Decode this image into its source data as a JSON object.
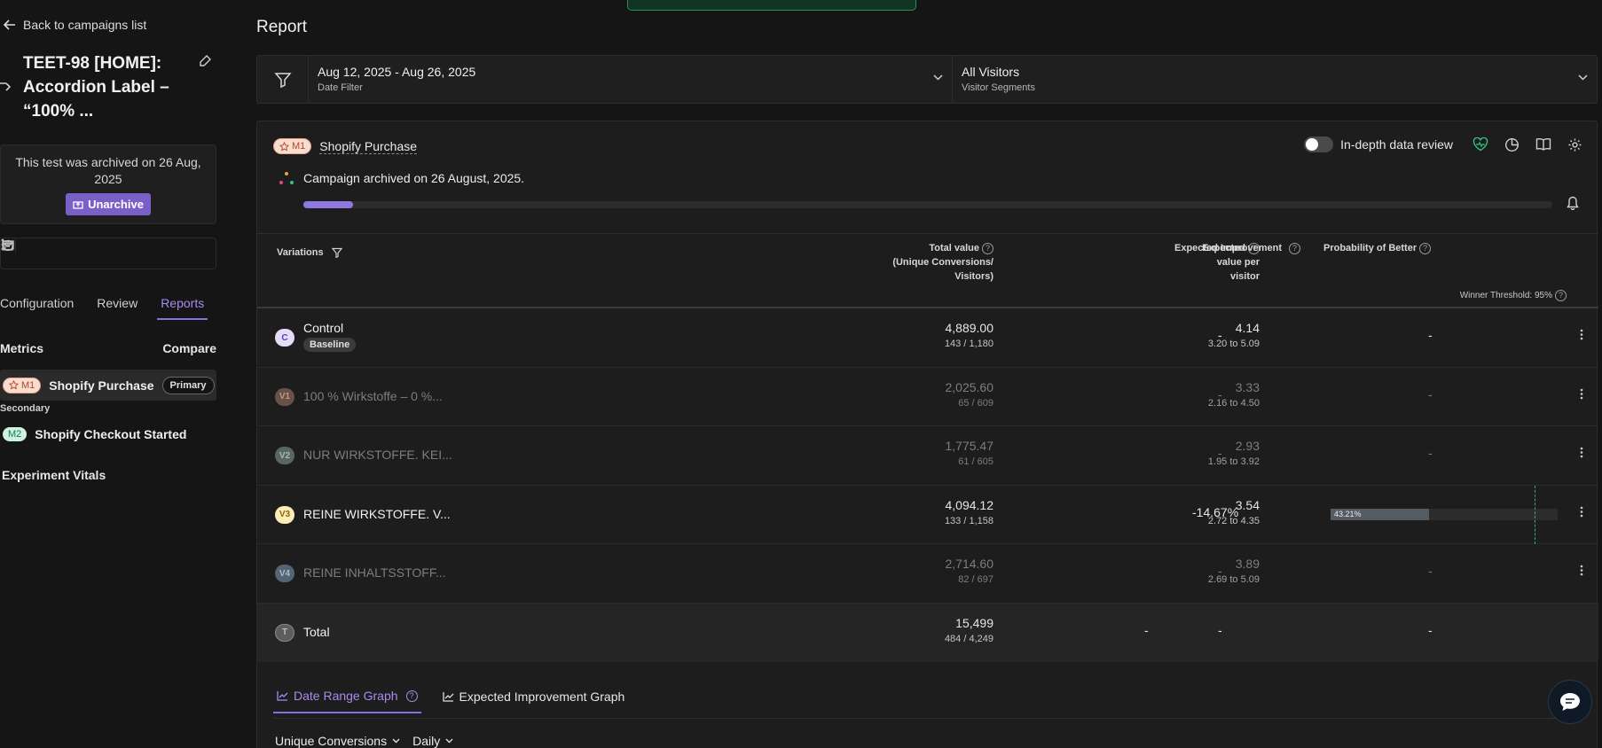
{
  "sidebar": {
    "back_label": "Back to campaigns list",
    "campaign_title": "TEET-98 [HOME]: Accordion Label – “100% ...",
    "archived_notice": "This test was archived on 26 Aug, 2025",
    "unarchive_label": "Unarchive",
    "tabs": [
      "Configuration",
      "Review",
      "Reports"
    ],
    "active_tab": "Reports",
    "metrics_heading": "Metrics",
    "compare_label": "Compare",
    "primary_metric": {
      "badge": "M1",
      "name": "Shopify Purchase",
      "tag": "Primary"
    },
    "secondary_label": "Secondary",
    "secondary_metric": {
      "badge": "M2",
      "name": "Shopify Checkout Started"
    },
    "vitals_label": "Experiment Vitals"
  },
  "main": {
    "title": "Report",
    "date_filter": {
      "value": "Aug 12, 2025 - Aug 26, 2025",
      "label": "Date Filter"
    },
    "segment_filter": {
      "value": "All Visitors",
      "label": "Visitor Segments"
    },
    "metric": {
      "badge": "M1",
      "name": "Shopify Purchase"
    },
    "in_depth_label": "In-depth data review",
    "archived_line": "Campaign archived on 26 August, 2025.",
    "progress_fraction": 0.04,
    "table": {
      "headers": {
        "variations": "Variations",
        "total_value_1": "Total value",
        "total_value_2": "(Unique Conversions/",
        "total_value_3": "Visitors)",
        "expected_1": "Expected",
        "expected_2": "value per",
        "expected_3": "visitor",
        "improvement": "Expected Improvement",
        "pob": "Probability of Better",
        "threshold": "Winner Threshold: 95%"
      },
      "rows": [
        {
          "badge": "C",
          "name": "Control",
          "tag": "Baseline",
          "total": "4,889.00",
          "conv": "143 / 1,180",
          "expected": "4.14",
          "range": "3.20 to 5.09",
          "improvement": "-",
          "pob": "-"
        },
        {
          "badge": "V1",
          "name": "100 % Wirkstoffe – 0 %...",
          "total": "2,025.60",
          "conv": "65 / 609",
          "expected": "3.33",
          "range": "2.16 to 4.50",
          "improvement": "-",
          "pob": "-"
        },
        {
          "badge": "V2",
          "name": "NUR WIRKSTOFFE. KEI...",
          "total": "1,775.47",
          "conv": "61 / 605",
          "expected": "2.93",
          "range": "1.95 to 3.92",
          "improvement": "-",
          "pob": "-"
        },
        {
          "badge": "V3",
          "name": "REINE WIRKSTOFFE. V...",
          "total": "4,094.12",
          "conv": "133 / 1,158",
          "expected": "3.54",
          "range": "2.72 to 4.35",
          "improvement": "-14.67%",
          "pob": "43.21%",
          "pob_fraction": 0.4321
        },
        {
          "badge": "V4",
          "name": "REINE INHALTSSTOFF...",
          "total": "2,714.60",
          "conv": "82 / 697",
          "expected": "3.89",
          "range": "2.69 to 5.09",
          "improvement": "-",
          "pob": "-"
        }
      ],
      "total_row": {
        "badge": "T",
        "name": "Total",
        "total": "15,499",
        "conv": "484 / 4,249",
        "expected": "-",
        "improvement": "-",
        "pob": "-"
      }
    },
    "graph_tabs": [
      "Date Range Graph",
      "Expected Improvement Graph"
    ],
    "dropdowns": [
      "Unique Conversions",
      "Daily"
    ]
  },
  "colors": {
    "accent": "#8a6fe0",
    "archive_button": "#7b5fc9",
    "m1_badge": "#f7ddd0",
    "m2_badge": "#cdf2e2",
    "success": "#2fae77"
  }
}
